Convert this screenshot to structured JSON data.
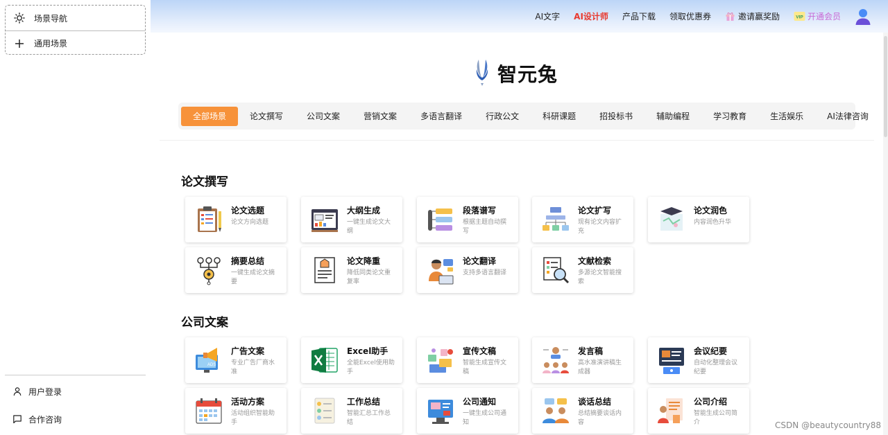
{
  "sidebar": {
    "items": [
      {
        "label": "场景导航",
        "icon": "sun-icon"
      },
      {
        "label": "通用场景",
        "icon": "plus-icon"
      }
    ],
    "bottom": [
      {
        "label": "用户登录",
        "icon": "user-icon"
      },
      {
        "label": "合作咨询",
        "icon": "chat-icon"
      }
    ]
  },
  "topnav": {
    "ai_text": "AI文字",
    "ai_designer": "AI设计师",
    "download": "产品下载",
    "coupon": "领取优惠券",
    "invite": "邀请赢奖励",
    "vip": "开通会员",
    "vip_badge": "VIP"
  },
  "brand": {
    "title": "智元兔",
    "accent": "#f7923a"
  },
  "tabs": [
    "全部场景",
    "论文撰写",
    "公司文案",
    "营销文案",
    "多语言翻译",
    "行政公文",
    "科研课题",
    "招投标书",
    "辅助编程",
    "学习教育",
    "生活娱乐",
    "AI法律咨询"
  ],
  "sections": [
    {
      "title": "论文撰写",
      "cards": [
        {
          "title": "论文选题",
          "desc": "论文方向选题",
          "icon": "clipboard-icon"
        },
        {
          "title": "大纲生成",
          "desc": "一键生成论文大纲",
          "icon": "outline-board-icon"
        },
        {
          "title": "段落谱写",
          "desc": "根据主题自动撰写",
          "icon": "paragraph-icon"
        },
        {
          "title": "论文扩写",
          "desc": "现有论文内容扩充",
          "icon": "flowchart-icon"
        },
        {
          "title": "论文润色",
          "desc": "内容润色升华",
          "icon": "graduation-icon"
        },
        {
          "title": "摘要总结",
          "desc": "一键生成论文摘要",
          "icon": "summary-icon"
        },
        {
          "title": "论文降重",
          "desc": "降低同类论文重复率",
          "icon": "document-icon"
        },
        {
          "title": "论文翻译",
          "desc": "支持多语言翻译",
          "icon": "translator-icon"
        },
        {
          "title": "文献检索",
          "desc": "多源论文智能搜索",
          "icon": "search-doc-icon"
        }
      ]
    },
    {
      "title": "公司文案",
      "cards": [
        {
          "title": "广告文案",
          "desc": "专业广告厂商水准",
          "icon": "megaphone-icon"
        },
        {
          "title": "Excel助手",
          "desc": "全能Excel使用助手",
          "icon": "excel-icon"
        },
        {
          "title": "宣传文稿",
          "desc": "智能生成宣传文稿",
          "icon": "promo-icon"
        },
        {
          "title": "发言稿",
          "desc": "高水准演讲稿生成器",
          "icon": "speech-icon"
        },
        {
          "title": "会议纪要",
          "desc": "自动化整理会议纪要",
          "icon": "meeting-icon"
        },
        {
          "title": "活动方案",
          "desc": "活动组织智能助手",
          "icon": "calendar-icon"
        },
        {
          "title": "工作总结",
          "desc": "智能汇总工作总结",
          "icon": "list-icon"
        },
        {
          "title": "公司通知",
          "desc": "一键生成公司通知",
          "icon": "notice-icon"
        },
        {
          "title": "谈话总结",
          "desc": "总结摘要谈话内容",
          "icon": "talk-icon"
        },
        {
          "title": "公司介绍",
          "desc": "智能生成公司简介",
          "icon": "company-icon"
        }
      ]
    }
  ],
  "watermark": "CSDN @beautycountry88"
}
